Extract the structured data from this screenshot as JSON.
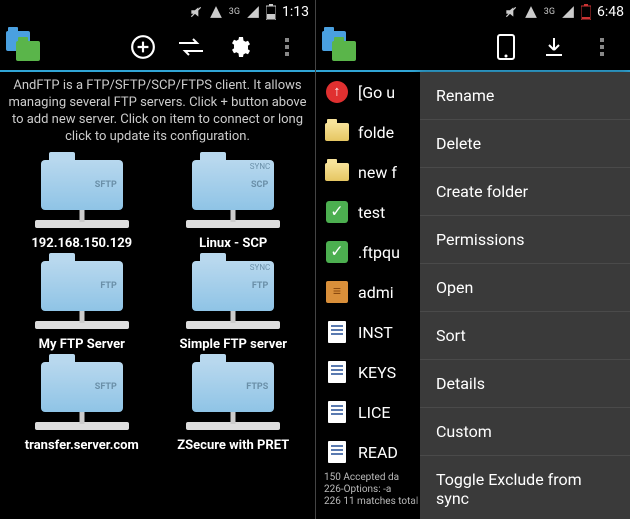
{
  "screen1": {
    "status": {
      "network_label": "3G",
      "clock": "1:13"
    },
    "intro": "AndFTP is a FTP/SFTP/SCP/FTPS client. It allows managing several FTP servers. Click + button above to add new server. Click on item to connect or long click to update its configuration.",
    "servers": [
      {
        "label": "192.168.150.129",
        "proto": "SFTP",
        "sync": false
      },
      {
        "label": "Linux - SCP",
        "proto": "SCP",
        "sync": true
      },
      {
        "label": "My FTP Server",
        "proto": "FTP",
        "sync": false
      },
      {
        "label": "Simple FTP server",
        "proto": "FTP",
        "sync": true
      },
      {
        "label": "transfer.server.com",
        "proto": "SFTP",
        "sync": false
      },
      {
        "label": "ZSecure with PRET",
        "proto": "FTPS",
        "sync": false
      }
    ]
  },
  "screen2": {
    "status": {
      "network_label": "3G",
      "clock": "6:48"
    },
    "files": [
      {
        "name": "[Go u",
        "icon": "up"
      },
      {
        "name": "folde",
        "icon": "folder"
      },
      {
        "name": "new f",
        "icon": "folder"
      },
      {
        "name": "test",
        "icon": "check"
      },
      {
        "name": ".ftpqu",
        "icon": "check"
      },
      {
        "name": "admi",
        "icon": "archive"
      },
      {
        "name": "INST",
        "icon": "doc"
      },
      {
        "name": "KEYS",
        "icon": "doc"
      },
      {
        "name": "LICE",
        "icon": "doc"
      },
      {
        "name": "READ",
        "icon": "doc"
      }
    ],
    "status_lines": [
      "150 Accepted da",
      "226-Options: -a",
      "226 11 matches total"
    ],
    "menu": [
      "Rename",
      "Delete",
      "Create folder",
      "Permissions",
      "Open",
      "Sort",
      "Details",
      "Custom",
      "Toggle Exclude from sync"
    ]
  }
}
